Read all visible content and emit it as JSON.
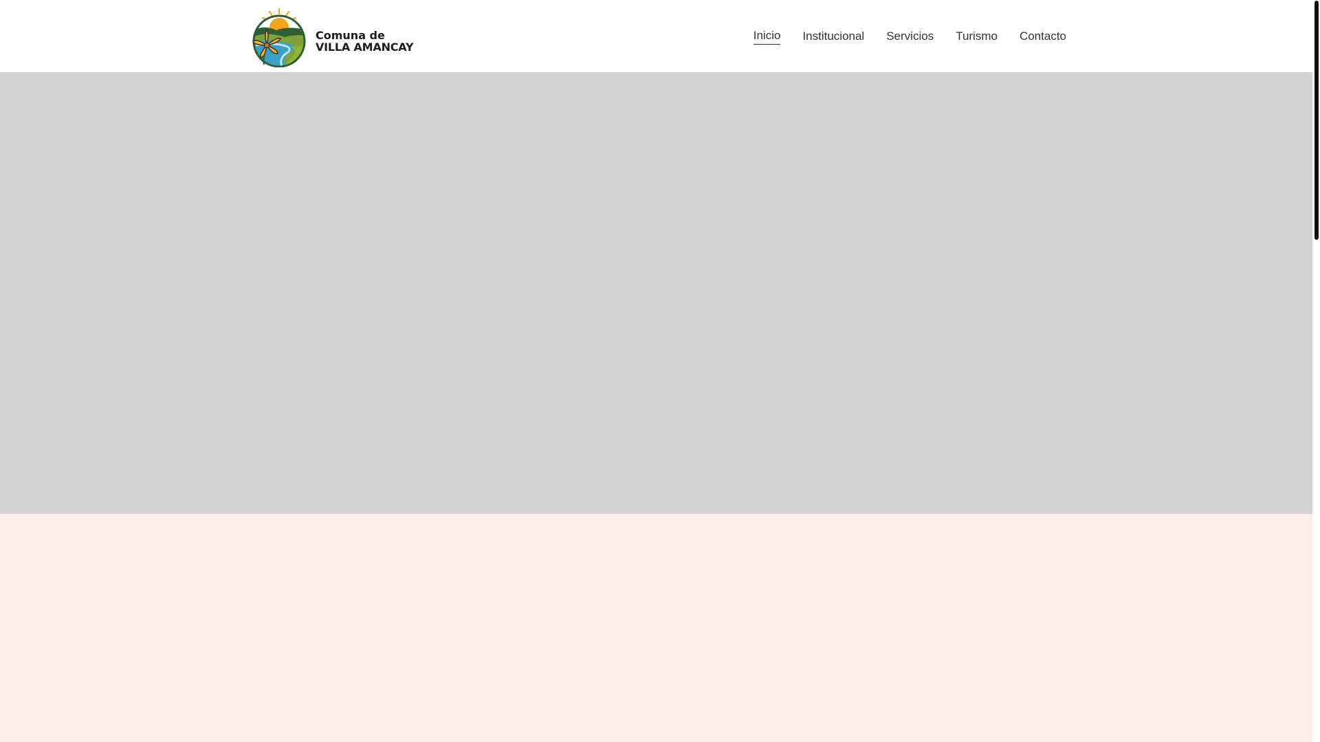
{
  "header": {
    "logo": {
      "line1": "Comuna de",
      "line2": "VILLA AMANCAY"
    },
    "nav": [
      {
        "label": "Inicio",
        "active": true
      },
      {
        "label": "Institucional",
        "active": false
      },
      {
        "label": "Servicios",
        "active": false
      },
      {
        "label": "Turismo",
        "active": false
      },
      {
        "label": "Contacto",
        "active": false
      }
    ]
  },
  "colors": {
    "hero_placeholder": "#d3d3d3",
    "section_band": "#fcefea",
    "nav_text": "#333333"
  },
  "icons": {
    "logo_emblem": "sun-hills-river-flower-icon"
  }
}
